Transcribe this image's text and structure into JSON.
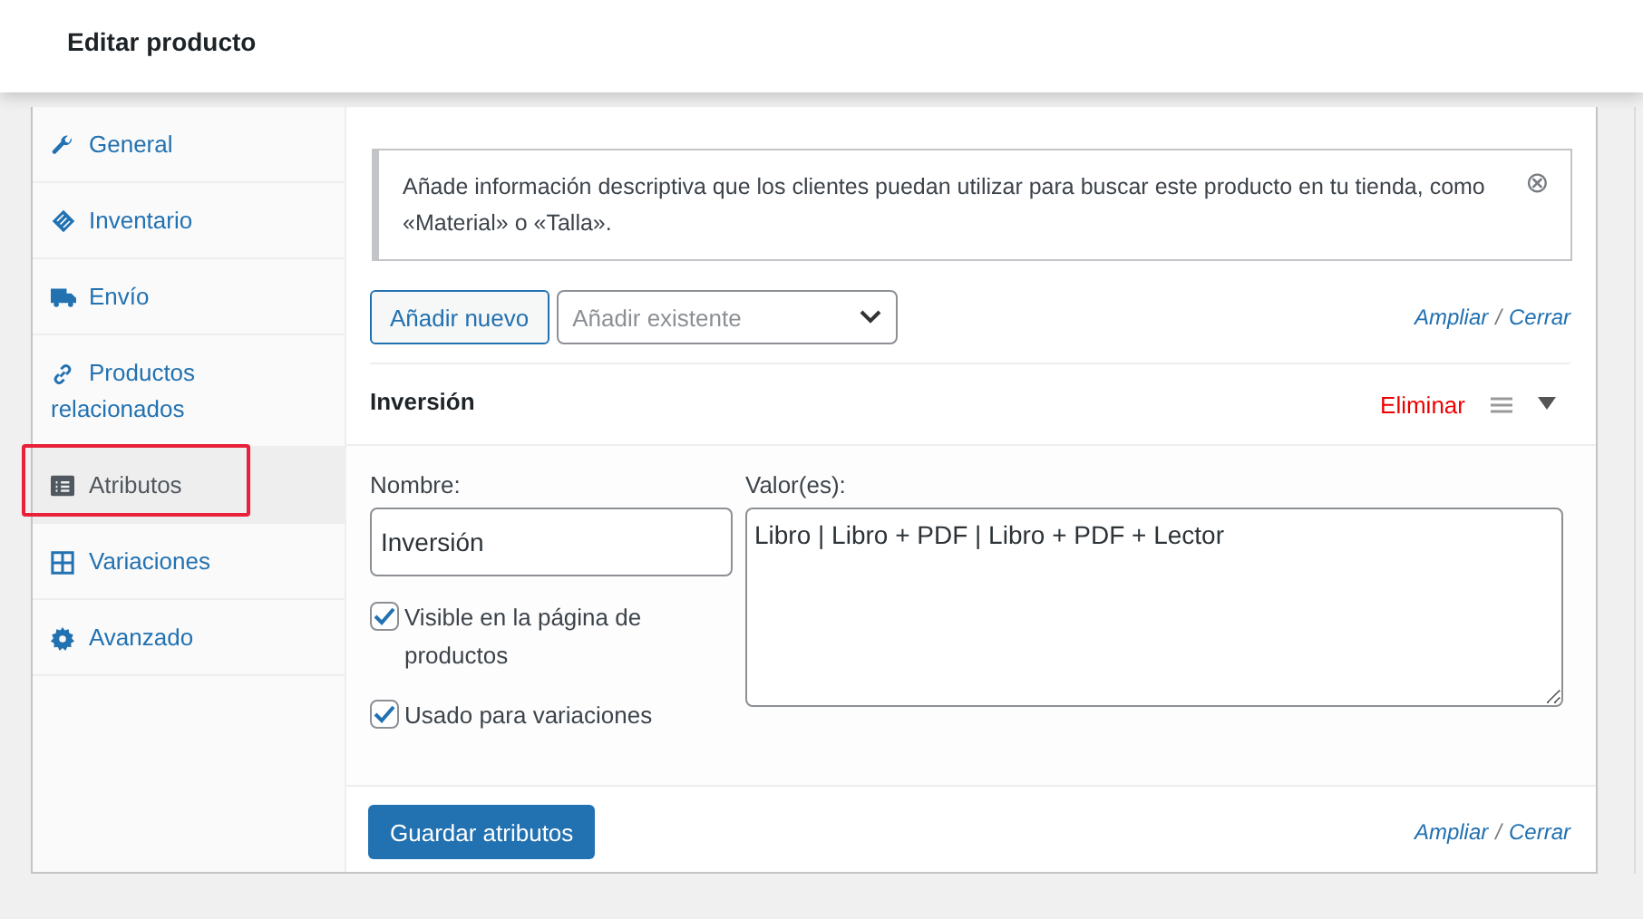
{
  "header": {
    "title": "Editar producto"
  },
  "sidebar": {
    "items": [
      {
        "label": "General",
        "kind": "wrench",
        "selected": false,
        "highlighted": false
      },
      {
        "label": "Inventario",
        "kind": "tag",
        "selected": false,
        "highlighted": false
      },
      {
        "label": "Envío",
        "kind": "truck",
        "selected": false,
        "highlighted": false
      },
      {
        "label": "Productos relacionados",
        "kind": "link",
        "selected": false,
        "highlighted": false
      },
      {
        "label": "Atributos",
        "kind": "list",
        "selected": true,
        "highlighted": true
      },
      {
        "label": "Variaciones",
        "kind": "grid",
        "selected": false,
        "highlighted": false
      },
      {
        "label": "Avanzado",
        "kind": "gear",
        "selected": false,
        "highlighted": false
      }
    ]
  },
  "notice": {
    "text": "Añade información descriptiva que los clientes puedan utilizar para buscar este producto en tu tienda, como «Material» o «Talla».",
    "close": "⊗"
  },
  "toolbar": {
    "add_button": "Añadir nuevo",
    "existing_select": {
      "placeholder": "Añadir existente"
    },
    "expand_link": "Ampliar",
    "separator": "/",
    "close_link": "Cerrar"
  },
  "attribute": {
    "title": "Inversión",
    "remove_link": "Eliminar",
    "expanded": true,
    "name_label": "Nombre:",
    "name_value": "Inversión",
    "values_label": "Valor(es):",
    "values_value": "Libro | Libro + PDF | Libro + PDF + Lector",
    "options": [
      {
        "label": "Visible en la página de productos",
        "checked": true
      },
      {
        "label": "Usado para variaciones",
        "checked": true
      }
    ]
  },
  "footer": {
    "save_button": "Guardar atributos",
    "expand_link": "Ampliar",
    "separator": "/",
    "close_link": "Cerrar"
  }
}
